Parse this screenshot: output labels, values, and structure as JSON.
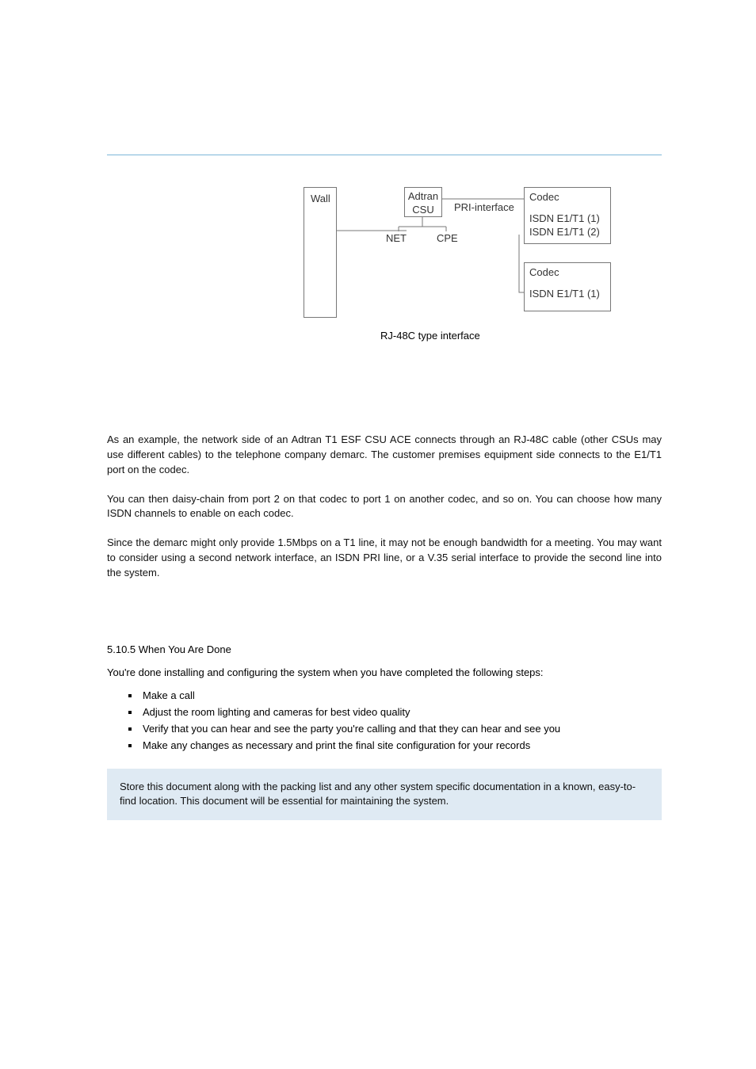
{
  "diagram": {
    "wall": "Wall",
    "csu_line1": "Adtran",
    "csu_line2": "CSU",
    "pri_label": "PRI-interface",
    "net_label": "NET",
    "cpe_label": "CPE",
    "codec_a_title": "Codec",
    "codec_a_port1": "ISDN E1/T1 (1)",
    "codec_a_port2": "ISDN E1/T1 (2)",
    "codec_b_title": "Codec",
    "codec_b_port1": "ISDN E1/T1 (1)",
    "caption": "RJ-48C type interface"
  },
  "paragraphs": {
    "p1": "As an example, the network side of an Adtran T1 ESF CSU ACE connects through an RJ-48C cable (other CSUs may use different cables) to the telephone company demarc. The customer premises equipment side connects to the E1/T1 port on the codec.",
    "p2": "You can then daisy-chain from port 2 on that codec to port 1 on another codec, and so on. You can choose how many ISDN channels to enable on each codec.",
    "p3": "Since the demarc might only provide 1.5Mbps on a T1 line, it may not be enough bandwidth for a meeting. You may want to consider using a second network interface, an ISDN PRI line, or a V.35 serial interface to provide the second line into the system."
  },
  "section2_title": "5.10.5 When You Are Done",
  "section2_body": "You're done installing and configuring the system when you have completed the following steps:",
  "bullets": [
    "Make a call",
    "Adjust the room lighting and cameras for best video quality",
    "Verify that you can hear and see the party you're calling and that they can hear and see you",
    "Make any changes as necessary and print the final site configuration for your records"
  ],
  "note": {
    "text": "Store this document along with the packing list and any other system specific documentation in a known, easy-to-find location. This document will be essential for maintaining the system."
  }
}
